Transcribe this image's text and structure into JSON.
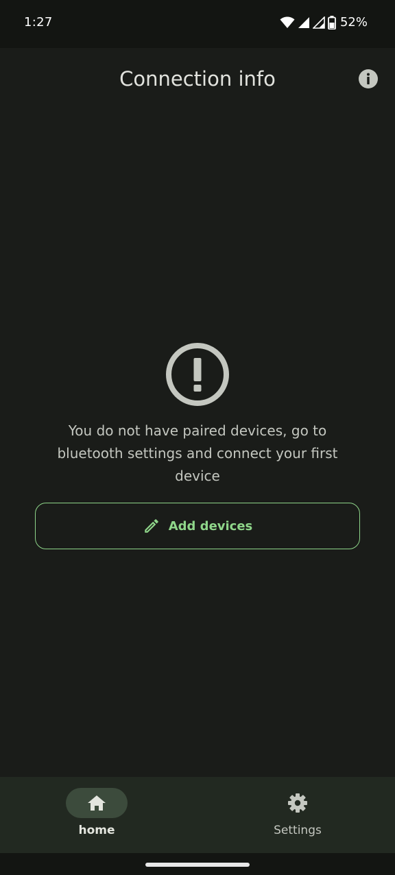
{
  "status_bar": {
    "time": "1:27",
    "battery": "52%",
    "icons": [
      "wifi-icon",
      "signal-icon",
      "signal-icon",
      "battery-icon"
    ]
  },
  "app_bar": {
    "title": "Connection info",
    "info_icon": "info-icon"
  },
  "empty_state": {
    "icon": "alert-circle-icon",
    "message": "You do not have paired devices, go to bluetooth settings and connect your first device",
    "button_label": "Add devices",
    "button_icon": "pencil-icon"
  },
  "bottom_nav": {
    "items": [
      {
        "label": "home",
        "icon": "home-icon",
        "selected": true
      },
      {
        "label": "Settings",
        "icon": "gear-icon",
        "selected": false
      }
    ]
  },
  "colors": {
    "background": "#1a1c19",
    "accent": "#8fd68a",
    "nav_background": "#222921",
    "nav_indicator": "#3c4b3c"
  }
}
